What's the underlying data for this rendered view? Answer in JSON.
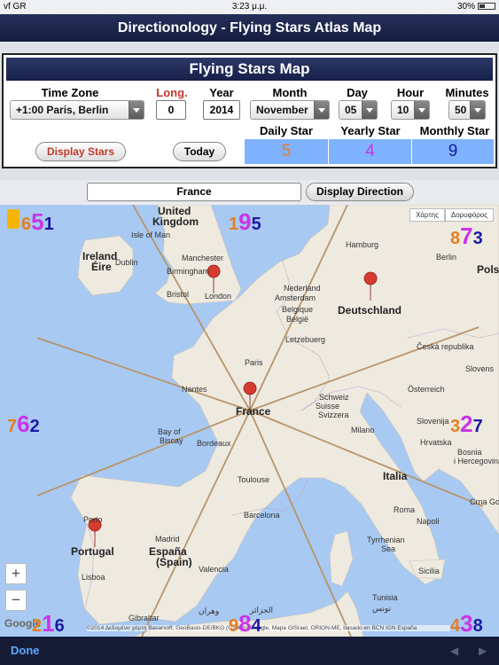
{
  "status": {
    "carrier": "vf GR",
    "time": "3:23 μ.μ.",
    "battery": "30%"
  },
  "nav": {
    "title": "Directionology - Flying Stars Atlas Map"
  },
  "panel": {
    "title": "Flying Stars Map",
    "labels": {
      "timezone": "Time Zone",
      "long": "Long.",
      "year": "Year",
      "month": "Month",
      "day": "Day",
      "hour": "Hour",
      "minutes": "Minutes"
    },
    "values": {
      "timezone": "+1:00 Paris, Berlin",
      "long": "0",
      "year": "2014",
      "month": "November",
      "day": "05",
      "hour": "10",
      "minutes": "50"
    },
    "display_stars_label": "Display Stars",
    "today_label": "Today",
    "stars": [
      {
        "label": "Daily Star",
        "value": "5",
        "color": "#e67e22"
      },
      {
        "label": "Yearly Star",
        "value": "4",
        "color": "#c934e6"
      },
      {
        "label": "Monthly Star",
        "value": "9",
        "color": "#1a1aa6"
      }
    ]
  },
  "search": {
    "location": "France",
    "display_direction_label": "Display Direction"
  },
  "map": {
    "type_buttons": [
      "Χάρτης",
      "Δορυφόρος"
    ],
    "zoom_in": "+",
    "zoom_out": "−",
    "google": "Google",
    "copyright": "©2014 Δεδομένα χάρτη Basarsoft, GeoBasis-DE/BKG (©2009), Google, Mapa GISrael, ORION-ME, basado en BCN IGN España",
    "labels": [
      {
        "text": "United",
        "big": true
      },
      {
        "text": "Kingdom",
        "big": true
      },
      {
        "text": "Isle of Man",
        "big": false
      },
      {
        "text": "Ireland",
        "big": true
      },
      {
        "text": "Éire",
        "big": true
      },
      {
        "text": "Dublin",
        "big": false
      },
      {
        "text": "Manchester",
        "big": false
      },
      {
        "text": "Birmingham",
        "big": false
      },
      {
        "text": "Bristol",
        "big": false
      },
      {
        "text": "London",
        "big": false
      },
      {
        "text": "Hamburg",
        "big": false
      },
      {
        "text": "Berlin",
        "big": false
      },
      {
        "text": "Pols",
        "big": true
      },
      {
        "text": "Nederland",
        "big": false
      },
      {
        "text": "Amsterdam",
        "big": false
      },
      {
        "text": "Belgique",
        "big": false
      },
      {
        "text": "België",
        "big": false
      },
      {
        "text": "Letzebuerg",
        "big": false
      },
      {
        "text": "Deutschland",
        "big": true
      },
      {
        "text": "Česká republika",
        "big": false
      },
      {
        "text": "Slovens",
        "big": false
      },
      {
        "text": "Paris",
        "big": false
      },
      {
        "text": "Nantes",
        "big": false
      },
      {
        "text": "France",
        "big": true
      },
      {
        "text": "Bay of",
        "big": false
      },
      {
        "text": "Biscay",
        "big": false
      },
      {
        "text": "Bordeaux",
        "big": false
      },
      {
        "text": "Toulouse",
        "big": false
      },
      {
        "text": "Schweiz",
        "big": false
      },
      {
        "text": "Suisse",
        "big": false
      },
      {
        "text": "Svizzera",
        "big": false
      },
      {
        "text": "Österreich",
        "big": false
      },
      {
        "text": "Milano",
        "big": false
      },
      {
        "text": "Slovenija",
        "big": false
      },
      {
        "text": "Hrvatska",
        "big": false
      },
      {
        "text": "Bosnia",
        "big": false
      },
      {
        "text": "i Hercegovina",
        "big": false
      },
      {
        "text": "Italia",
        "big": true
      },
      {
        "text": "Crna Gora",
        "big": false
      },
      {
        "text": "Roma",
        "big": false
      },
      {
        "text": "Tyrrhenian",
        "big": false
      },
      {
        "text": "Sea",
        "big": false
      },
      {
        "text": "Porto",
        "big": false
      },
      {
        "text": "Portugal",
        "big": true
      },
      {
        "text": "Lisboa",
        "big": false
      },
      {
        "text": "Madrid",
        "big": false
      },
      {
        "text": "España",
        "big": true
      },
      {
        "text": "(Spain)",
        "big": true
      },
      {
        "text": "Gibraltar",
        "big": false
      },
      {
        "text": "Barcelona",
        "big": false
      },
      {
        "text": "Valencia",
        "big": false
      },
      {
        "text": "وهران",
        "big": false
      },
      {
        "text": "الجزائر",
        "big": false
      },
      {
        "text": "تونس",
        "big": false
      },
      {
        "text": "Sicilia",
        "big": false
      },
      {
        "text": "Napoli",
        "big": false
      },
      {
        "text": "Tunisia",
        "big": false
      }
    ],
    "trios": [
      {
        "sector": "nw",
        "stars": [
          {
            "v": "6",
            "c": "#e67e22"
          },
          {
            "v": "5",
            "c": "#c934e6"
          },
          {
            "v": "1",
            "c": "#1a1aa6"
          }
        ]
      },
      {
        "sector": "n",
        "stars": [
          {
            "v": "1",
            "c": "#e67e22"
          },
          {
            "v": "9",
            "c": "#c934e6"
          },
          {
            "v": "5",
            "c": "#1a1aa6"
          }
        ]
      },
      {
        "sector": "ne",
        "stars": [
          {
            "v": "8",
            "c": "#e67e22"
          },
          {
            "v": "7",
            "c": "#c934e6"
          },
          {
            "v": "3",
            "c": "#1a1aa6"
          }
        ]
      },
      {
        "sector": "w",
        "stars": [
          {
            "v": "7",
            "c": "#e67e22"
          },
          {
            "v": "6",
            "c": "#c934e6"
          },
          {
            "v": "2",
            "c": "#1a1aa6"
          }
        ]
      },
      {
        "sector": "e",
        "stars": [
          {
            "v": "3",
            "c": "#e67e22"
          },
          {
            "v": "2",
            "c": "#c934e6"
          },
          {
            "v": "7",
            "c": "#1a1aa6"
          }
        ]
      },
      {
        "sector": "sw",
        "stars": [
          {
            "v": "2",
            "c": "#e67e22"
          },
          {
            "v": "1",
            "c": "#c934e6"
          },
          {
            "v": "6",
            "c": "#1a1aa6"
          }
        ]
      },
      {
        "sector": "s",
        "stars": [
          {
            "v": "9",
            "c": "#e67e22"
          },
          {
            "v": "8",
            "c": "#c934e6"
          },
          {
            "v": "4",
            "c": "#1a1aa6"
          }
        ]
      },
      {
        "sector": "se",
        "stars": [
          {
            "v": "4",
            "c": "#e67e22"
          },
          {
            "v": "3",
            "c": "#c934e6"
          },
          {
            "v": "8",
            "c": "#1a1aa6"
          }
        ]
      }
    ]
  },
  "toolbar": {
    "done_label": "Done"
  }
}
